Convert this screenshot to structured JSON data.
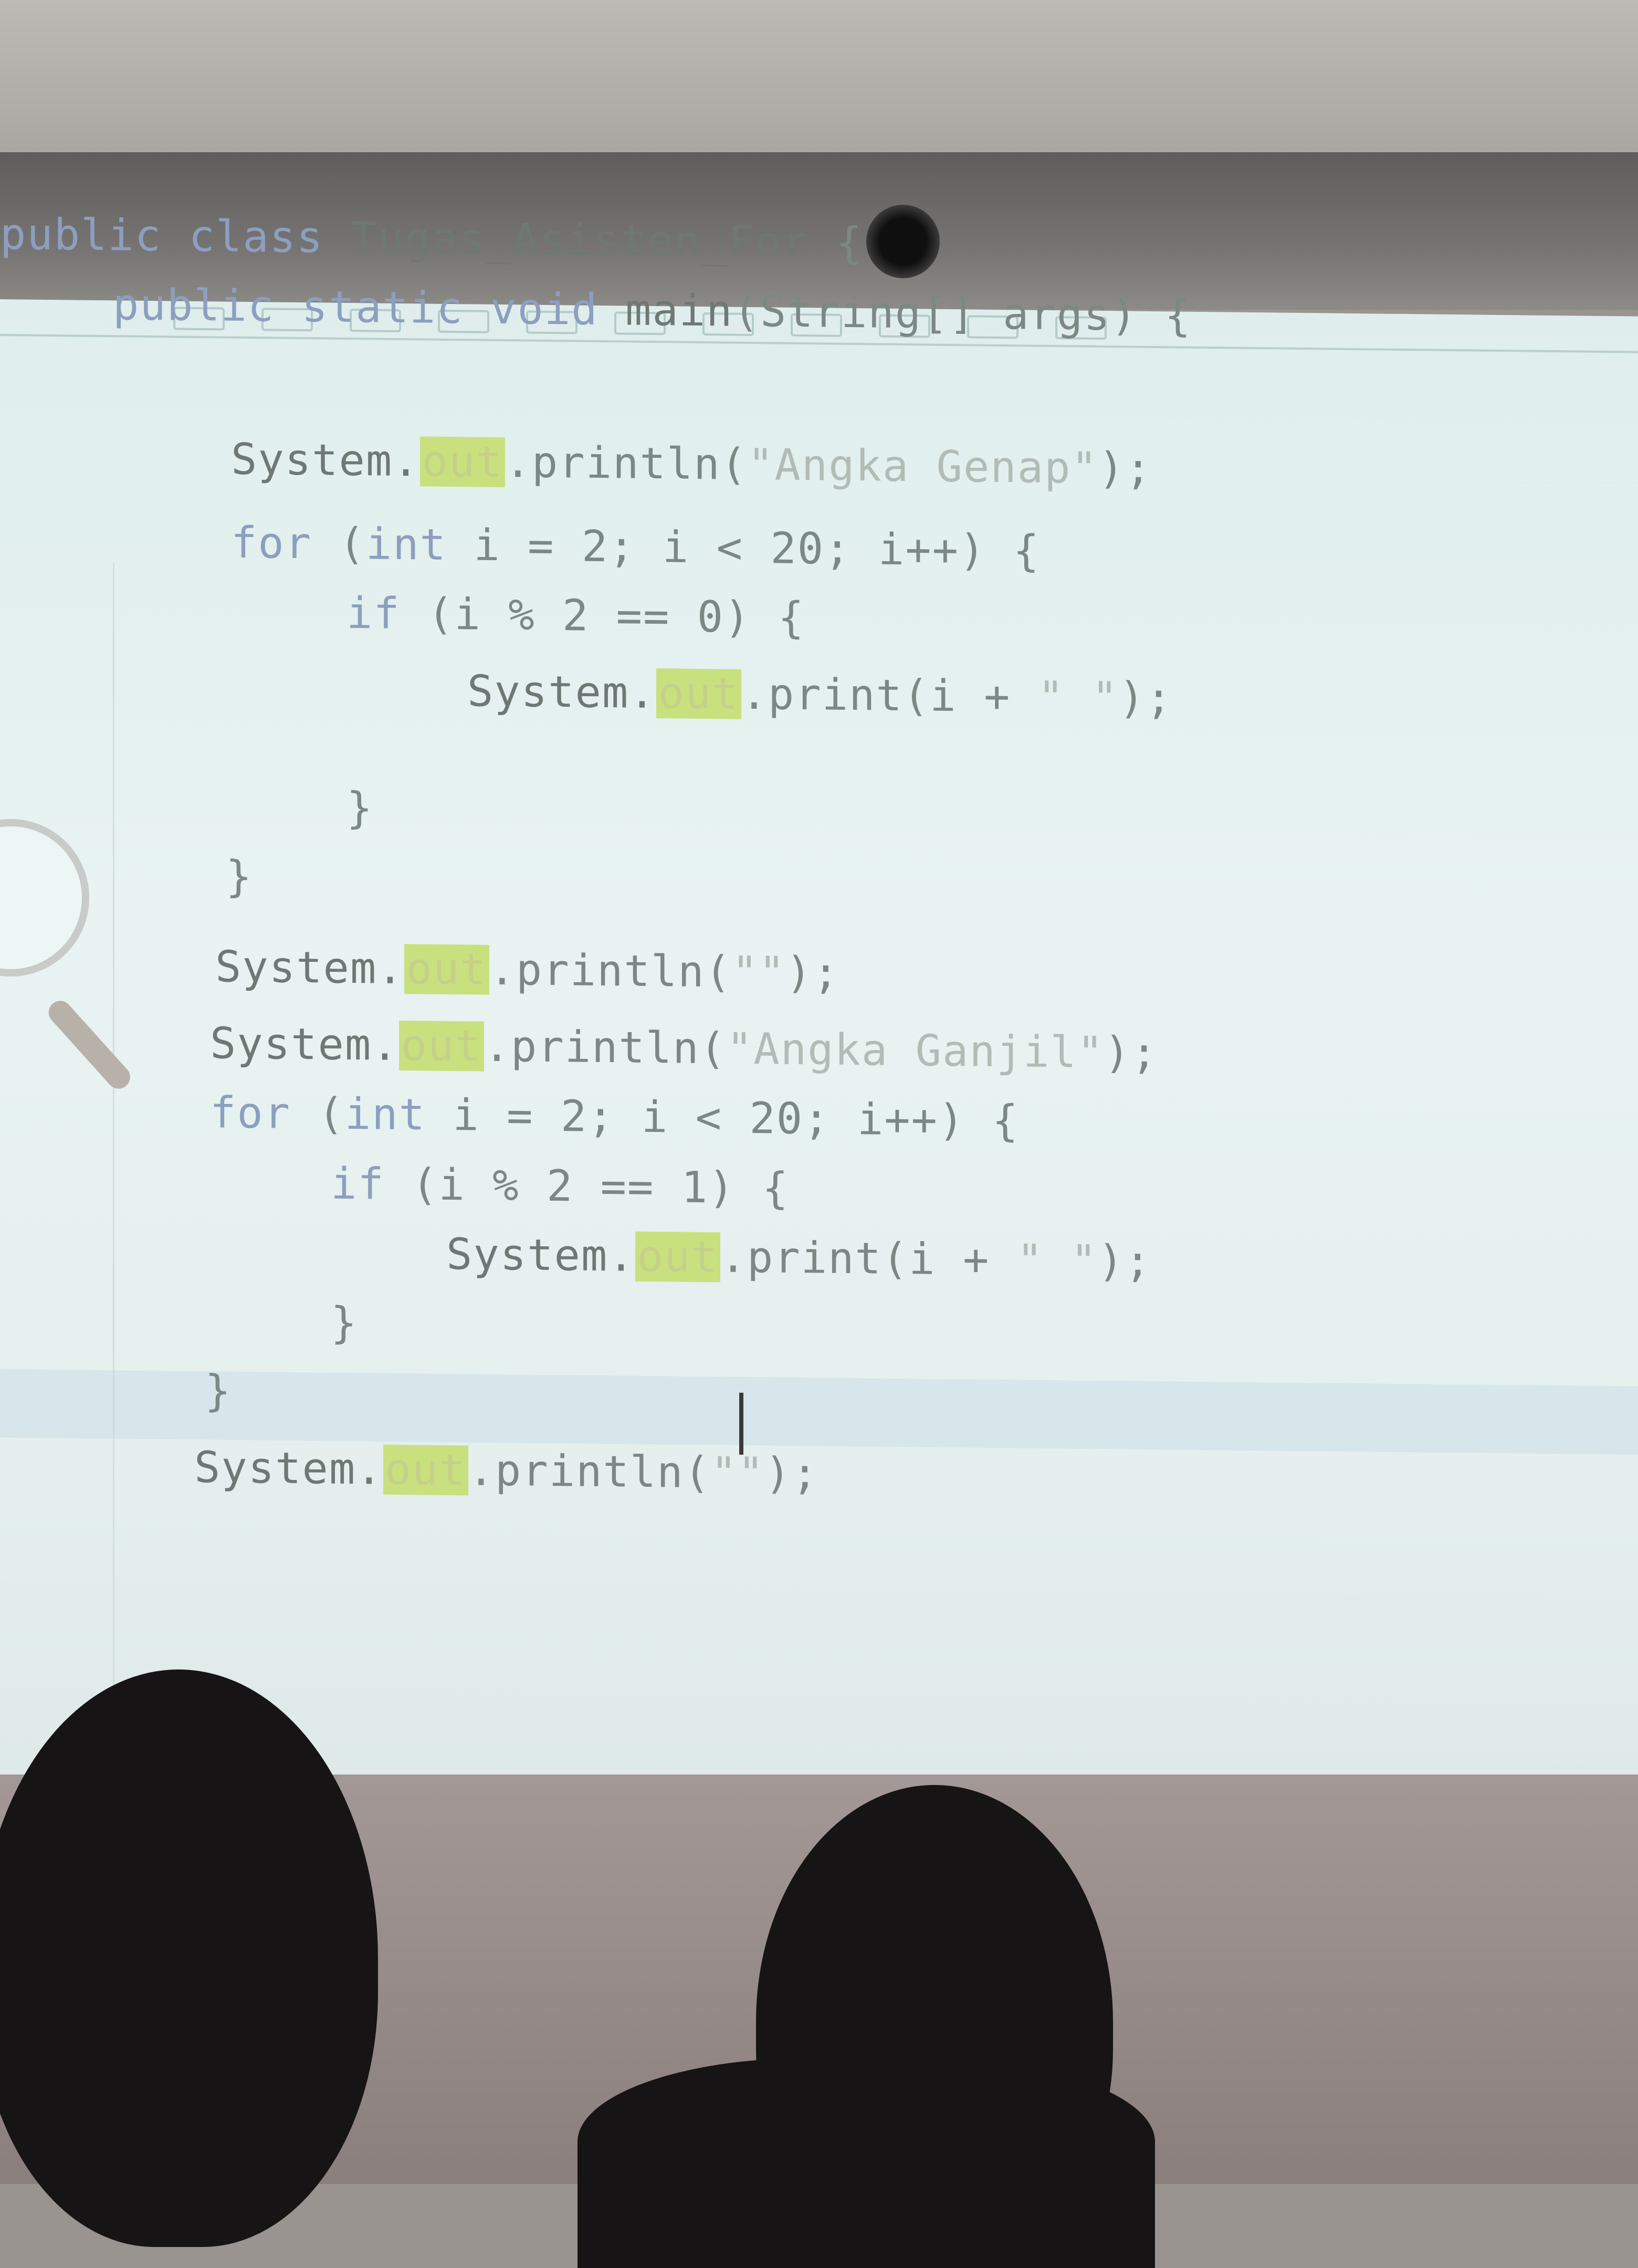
{
  "editor": {
    "lines": [
      {
        "id": "line-class",
        "parts": [
          {
            "t": "public class ",
            "c": "kw"
          },
          {
            "t": "Tugas_Asisten_For",
            "c": "cls"
          },
          {
            "t": " {",
            "c": "tok"
          }
        ]
      },
      {
        "id": "line-main",
        "parts": [
          {
            "t": "public static void ",
            "c": "kw"
          },
          {
            "t": "main",
            "c": "cls"
          },
          {
            "t": "(String[] args) {",
            "c": "tok"
          }
        ]
      },
      {
        "id": "line-print-genap",
        "parts": [
          {
            "t": "System.",
            "c": "cls"
          },
          {
            "t": "out",
            "c": "out"
          },
          {
            "t": ".println(",
            "c": "tok"
          },
          {
            "t": "\"Angka Genap\"",
            "c": "str"
          },
          {
            "t": ");",
            "c": "tok"
          }
        ]
      },
      {
        "id": "line-for-1",
        "parts": [
          {
            "t": "for ",
            "c": "kw"
          },
          {
            "t": "(",
            "c": "tok"
          },
          {
            "t": "int ",
            "c": "kw"
          },
          {
            "t": "i = 2; i < 20; i++) {",
            "c": "tok"
          }
        ]
      },
      {
        "id": "line-if-1",
        "parts": [
          {
            "t": "if ",
            "c": "kw"
          },
          {
            "t": "(i % 2 == 0) {",
            "c": "tok"
          }
        ]
      },
      {
        "id": "line-print-i-1",
        "parts": [
          {
            "t": "System.",
            "c": "cls"
          },
          {
            "t": "out",
            "c": "out"
          },
          {
            "t": ".print(i + ",
            "c": "tok"
          },
          {
            "t": "\" \"",
            "c": "str"
          },
          {
            "t": ");",
            "c": "tok"
          }
        ]
      },
      {
        "id": "line-close-if-1",
        "parts": [
          {
            "t": "}",
            "c": "tok"
          }
        ]
      },
      {
        "id": "line-close-for-1",
        "parts": [
          {
            "t": "}",
            "c": "tok"
          }
        ]
      },
      {
        "id": "line-println-empty-1",
        "parts": [
          {
            "t": "System.",
            "c": "cls"
          },
          {
            "t": "out",
            "c": "out"
          },
          {
            "t": ".println(",
            "c": "tok"
          },
          {
            "t": "\"\"",
            "c": "str"
          },
          {
            "t": ");",
            "c": "tok"
          }
        ]
      },
      {
        "id": "line-print-ganjil",
        "parts": [
          {
            "t": "System.",
            "c": "cls"
          },
          {
            "t": "out",
            "c": "out"
          },
          {
            "t": ".println(",
            "c": "tok"
          },
          {
            "t": "\"Angka Ganjil\"",
            "c": "str"
          },
          {
            "t": ");",
            "c": "tok"
          }
        ]
      },
      {
        "id": "line-for-2",
        "parts": [
          {
            "t": "for ",
            "c": "kw"
          },
          {
            "t": "(",
            "c": "tok"
          },
          {
            "t": "int ",
            "c": "kw"
          },
          {
            "t": "i = 2; i < 20; i++) {",
            "c": "tok"
          }
        ]
      },
      {
        "id": "line-if-2",
        "parts": [
          {
            "t": "if ",
            "c": "kw"
          },
          {
            "t": "(i % 2 == 1) {",
            "c": "tok"
          }
        ]
      },
      {
        "id": "line-print-i-2",
        "parts": [
          {
            "t": "System.",
            "c": "cls"
          },
          {
            "t": "out",
            "c": "out"
          },
          {
            "t": ".print(i + ",
            "c": "tok"
          },
          {
            "t": "\" \"",
            "c": "str"
          },
          {
            "t": ");",
            "c": "tok"
          }
        ]
      },
      {
        "id": "line-close-if-2",
        "parts": [
          {
            "t": "}",
            "c": "tok"
          }
        ]
      },
      {
        "id": "line-close-for-2",
        "parts": [
          {
            "t": "}",
            "c": "tok"
          }
        ]
      },
      {
        "id": "line-println-empty-2",
        "parts": [
          {
            "t": "System.",
            "c": "cls"
          },
          {
            "t": "out",
            "c": "out"
          },
          {
            "t": ".println(",
            "c": "tok"
          },
          {
            "t": "\"\"",
            "c": "str"
          },
          {
            "t": ");",
            "c": "tok"
          }
        ]
      }
    ]
  },
  "colors": {
    "keyword": "#8d9fc0",
    "field_highlight": "#c9e07e",
    "screen_bg": "#e4efee"
  }
}
